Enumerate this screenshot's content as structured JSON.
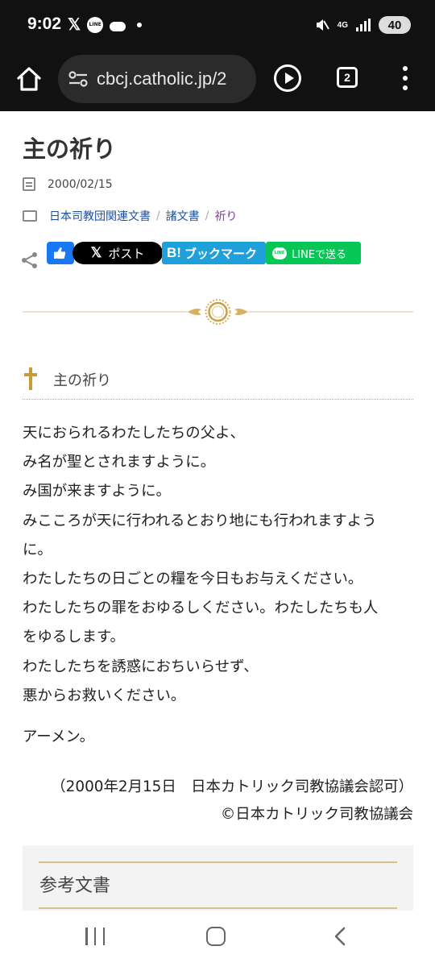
{
  "status_bar": {
    "time": "9:02",
    "network": "4G",
    "battery": "40",
    "icons": [
      "x-icon",
      "line-icon",
      "cloud-icon",
      "dot-icon",
      "mute-icon",
      "signal-icon",
      "battery-icon"
    ]
  },
  "browser": {
    "url": "cbcj.catholic.jp/2",
    "tab_count": "2"
  },
  "article": {
    "title": "主の祈り",
    "date": "2000/02/15",
    "categories": [
      {
        "label": "日本司教団関連文書"
      },
      {
        "label": "諸文書"
      },
      {
        "label": "祈り"
      }
    ],
    "category_separator": "/",
    "share": {
      "x_label": "ポスト",
      "x_logo": "𝕏",
      "hatena_logo": "B!",
      "hatena_label": "ブックマーク",
      "line_logo": "LINE",
      "line_label": "LINEで送る"
    },
    "section_title": "主の祈り",
    "prayer_lines": [
      "天におられるわたしたちの父よ、",
      "み名が聖とされますように。",
      "み国が来ますように。",
      "みこころが天に行われるとおり地にも行われますよう",
      "に。",
      "わたしたちの日ごとの糧を今日もお与えください。",
      "わたしたちの罪をおゆるしください。わたしたちも人",
      "をゆるします。",
      "わたしたちを誘惑におちいらせず、",
      "悪からお救いください。"
    ],
    "amen": "アーメン。",
    "approval": "（2000年2月15日　日本カトリック司教協議会認可）",
    "copyright": "©日本カトリック司教協議会",
    "reference_title": "参考文書"
  },
  "colors": {
    "gold": "#c7a969",
    "link": "#1a4fa0",
    "active_link": "#8a3aa0",
    "facebook": "#1877f2",
    "hatena": "#1fa0db",
    "line": "#06c755"
  }
}
